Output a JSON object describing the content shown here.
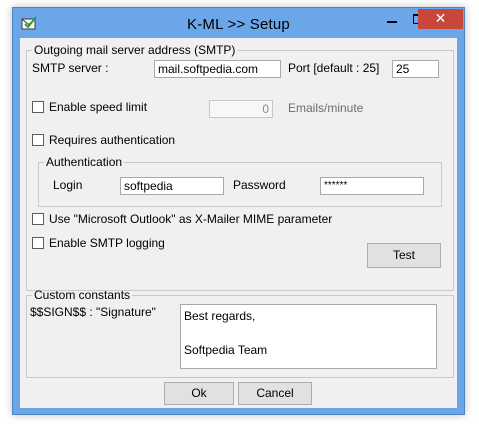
{
  "window": {
    "title": "K-ML >> Setup",
    "close_glyph": "✕"
  },
  "smtp": {
    "legend": "Outgoing mail server address (SMTP)",
    "server_label": "SMTP server :",
    "server_value": "mail.softpedia.com",
    "port_label": "Port [default : 25]",
    "port_value": "25",
    "speed_limit_label": "Enable speed limit",
    "speed_limit_checked": false,
    "speed_value": "0",
    "speed_unit": "Emails/minute",
    "auth_required_label": "Requires authentication",
    "auth_required_checked": false,
    "auth": {
      "legend": "Authentication",
      "login_label": "Login",
      "login_value": "softpedia",
      "password_label": "Password",
      "password_value": "******"
    },
    "outlook_label": "Use \"Microsoft Outlook\" as X-Mailer MIME parameter",
    "outlook_checked": false,
    "logging_label": "Enable SMTP logging",
    "logging_checked": false,
    "test_button": "Test"
  },
  "constants": {
    "legend": "Custom constants",
    "sign_label": "$$SIGN$$ : \"Signature\"",
    "signature_text": "Best regards,\n\nSoftpedia Team"
  },
  "buttons": {
    "ok": "Ok",
    "cancel": "Cancel"
  },
  "colors": {
    "titlebar": "#6aa6e8",
    "close": "#c7483b",
    "client": "#f0f0f0"
  }
}
